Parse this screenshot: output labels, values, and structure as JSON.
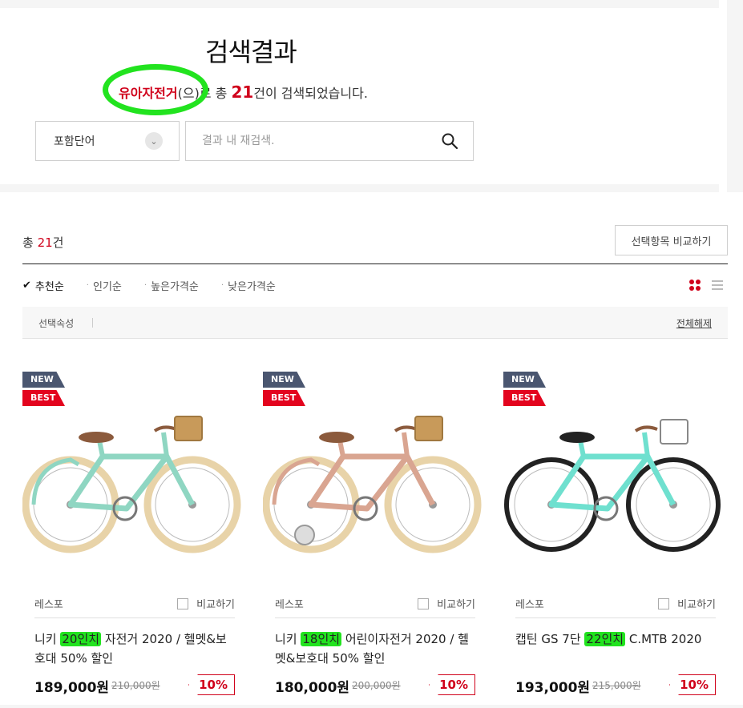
{
  "header": {
    "title": "검색결과",
    "keyword": "유아자전거",
    "summary_mid": "(으)로 총 ",
    "count": "21",
    "summary_end": "건이 검색되었습니다.",
    "filter_select": "포함단어",
    "search_placeholder": "결과 내 재검색."
  },
  "results": {
    "total_prefix": "총 ",
    "total_count": "21",
    "total_suffix": "건",
    "compare_button": "선택항목 비교하기",
    "sort_options": [
      "추천순",
      "인기순",
      "높은가격순",
      "낮은가격순"
    ],
    "active_sort": "추천순",
    "attr_label": "선택속성",
    "clear_all": "전체해제"
  },
  "products": [
    {
      "badge_new": "NEW",
      "badge_best": "BEST",
      "brand": "레스포",
      "compare": "비교하기",
      "name_pre": "니키 ",
      "name_hl": "20인치",
      "name_post": " 자전거 2020 / 헬멧&보호대 50% 할인",
      "price": "189,000원",
      "orig_price": "210,000원",
      "discount": "10%",
      "frame_color": "#8fd6c2",
      "wheel_color": "#e8d3a8"
    },
    {
      "badge_new": "NEW",
      "badge_best": "BEST",
      "brand": "레스포",
      "compare": "비교하기",
      "name_pre": "니키 ",
      "name_hl": "18인치",
      "name_post": " 어린이자전거 2020 / 헬멧&보호대 50% 할인",
      "price": "180,000원",
      "orig_price": "200,000원",
      "discount": "10%",
      "frame_color": "#d9a591",
      "wheel_color": "#e8d3a8"
    },
    {
      "badge_new": "NEW",
      "badge_best": "BEST",
      "brand": "레스포",
      "compare": "비교하기",
      "name_pre": "캡틴 GS 7단 ",
      "name_hl": "22인치",
      "name_post": " C.MTB 2020",
      "price": "193,000원",
      "orig_price": "215,000원",
      "discount": "10%",
      "frame_color": "#6fe0cf",
      "wheel_color": "#222222"
    }
  ]
}
